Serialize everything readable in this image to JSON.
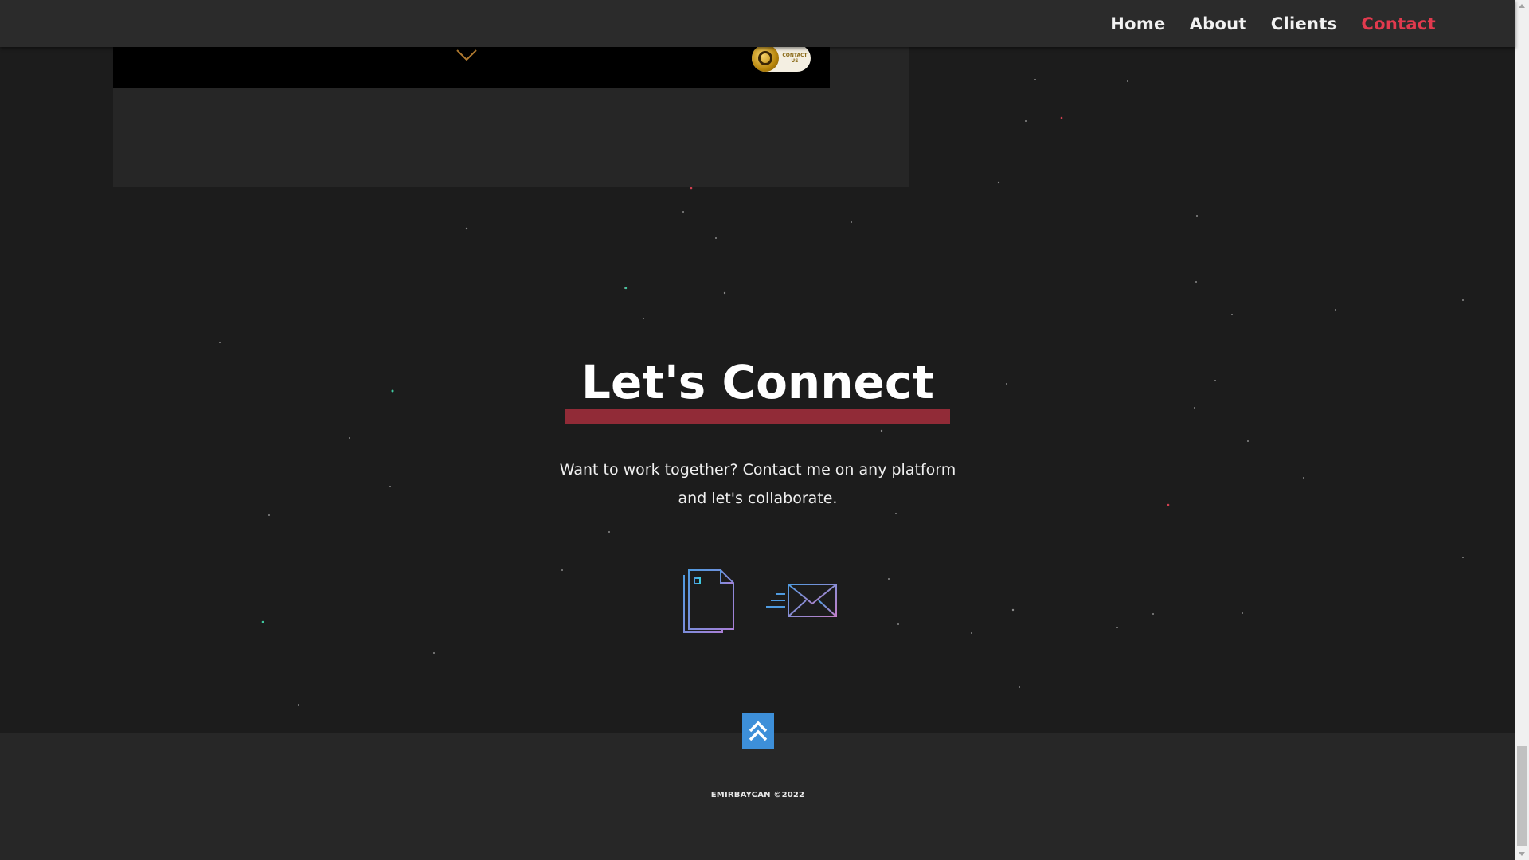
{
  "nav": {
    "items": [
      {
        "label": "Home",
        "active": false
      },
      {
        "label": "About",
        "active": false
      },
      {
        "label": "Clients",
        "active": false
      },
      {
        "label": "Contact",
        "active": true
      }
    ]
  },
  "portfolio_card": {
    "badge_text": "CONTACT US"
  },
  "connect": {
    "title": "Let's Connect",
    "text": "Want to work together? Contact me on any platform and let's collaborate."
  },
  "footer": {
    "copyright": "EMIRBAYCAN ©2022"
  },
  "colors": {
    "background": "#1c1c1c",
    "navbar": "#2b2b2b",
    "accent": "#e23a4e",
    "underline": "#912b37",
    "back_to_top": "#3d8fd9",
    "footer": "#272727"
  },
  "icons": {
    "resume": "document-icon",
    "email": "envelope-icon",
    "back_to_top": "double-chevron-up-icon",
    "scroll_hint": "chevron-down-icon"
  }
}
